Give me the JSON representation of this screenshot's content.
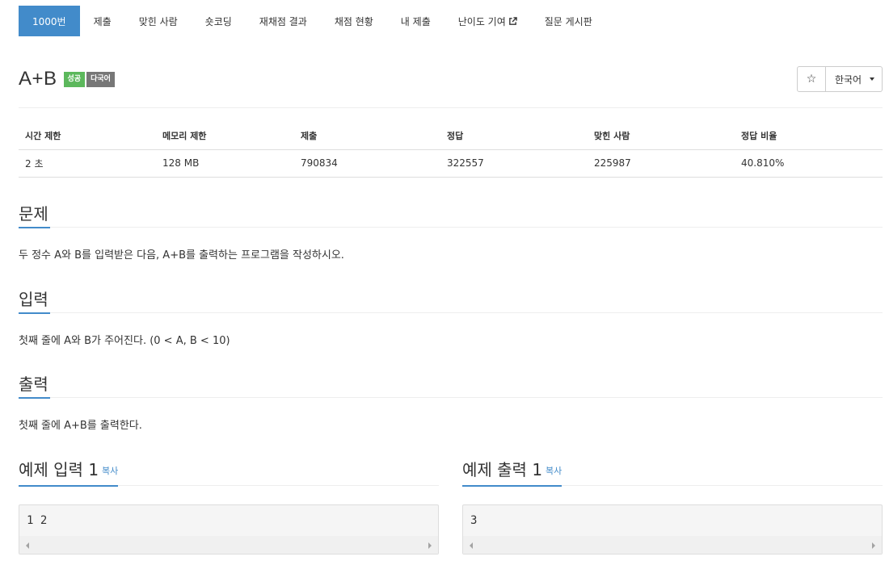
{
  "tabs": [
    {
      "label": "1000번",
      "active": true
    },
    {
      "label": "제출"
    },
    {
      "label": "맞힌 사람"
    },
    {
      "label": "숏코딩"
    },
    {
      "label": "재채점 결과"
    },
    {
      "label": "채점 현황"
    },
    {
      "label": "내 제출"
    },
    {
      "label": "난이도 기여",
      "icon": "external-link-icon"
    },
    {
      "label": "질문 게시판"
    }
  ],
  "problem": {
    "title": "A+B",
    "badges": [
      "성공",
      "다국어"
    ]
  },
  "controls": {
    "star": "☆",
    "language": "한국어"
  },
  "info": {
    "headers": [
      "시간 제한",
      "메모리 제한",
      "제출",
      "정답",
      "맞힌 사람",
      "정답 비율"
    ],
    "values": [
      "2 초",
      "128 MB",
      "790834",
      "322557",
      "225987",
      "40.810%"
    ]
  },
  "sections": {
    "problem": {
      "title": "문제",
      "text": "두 정수 A와 B를 입력받은 다음, A+B를 출력하는 프로그램을 작성하시오."
    },
    "input": {
      "title": "입력",
      "text": "첫째 줄에 A와 B가 주어진다. (0 < A, B < 10)"
    },
    "output": {
      "title": "출력",
      "text": "첫째 줄에 A+B를 출력한다."
    }
  },
  "examples": {
    "input": {
      "title": "예제 입력 1",
      "copy": "복사",
      "content": "1 2"
    },
    "output": {
      "title": "예제 출력 1",
      "copy": "복사",
      "content": "3"
    }
  },
  "colors": {
    "accent": "#428bca",
    "success": "#5cb85c",
    "badge_gray": "#777777"
  }
}
